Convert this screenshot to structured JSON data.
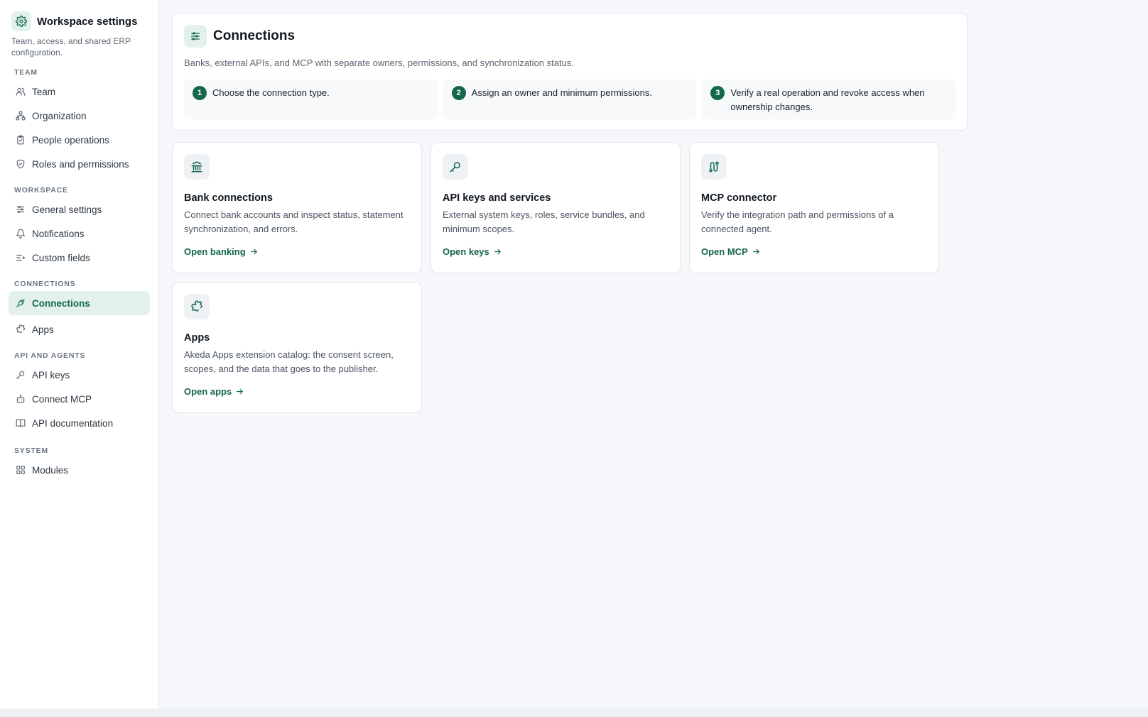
{
  "sidebar": {
    "title": "Workspace settings",
    "subtitle": "Team, access, and shared ERP configuration.",
    "sections": [
      {
        "label": "TEAM",
        "items": [
          {
            "label": "Team",
            "icon": "users-icon"
          },
          {
            "label": "Organization",
            "icon": "org-chart-icon"
          },
          {
            "label": "People operations",
            "icon": "clipboard-icon"
          },
          {
            "label": "Roles and permissions",
            "icon": "shield-icon"
          }
        ]
      },
      {
        "label": "WORKSPACE",
        "items": [
          {
            "label": "General settings",
            "icon": "sliders-icon"
          },
          {
            "label": "Notifications",
            "icon": "bell-icon"
          },
          {
            "label": "Custom fields",
            "icon": "custom-fields-icon"
          }
        ]
      },
      {
        "label": "CONNECTIONS",
        "items": [
          {
            "label": "Connections",
            "icon": "plug-icon",
            "active": true
          },
          {
            "label": "Apps",
            "icon": "puzzle-icon"
          }
        ]
      },
      {
        "label": "API AND AGENTS",
        "items": [
          {
            "label": "API keys",
            "icon": "key-icon"
          },
          {
            "label": "Connect MCP",
            "icon": "bot-icon"
          },
          {
            "label": "API documentation",
            "icon": "book-icon"
          }
        ]
      },
      {
        "label": "SYSTEM",
        "items": [
          {
            "label": "Modules",
            "icon": "modules-icon"
          }
        ]
      }
    ]
  },
  "header": {
    "title": "Connections",
    "description": "Banks, external APIs, and MCP with separate owners, permissions, and synchronization status.",
    "steps": [
      {
        "num": "1",
        "text": "Choose the connection type."
      },
      {
        "num": "2",
        "text": "Assign an owner and minimum permissions."
      },
      {
        "num": "3",
        "text": "Verify a real operation and revoke access when ownership changes."
      }
    ]
  },
  "cards": [
    {
      "title": "Bank connections",
      "description": "Connect bank accounts and inspect status, statement synchronization, and errors.",
      "link": "Open banking",
      "icon": "bank-icon"
    },
    {
      "title": "API keys and services",
      "description": "External system keys, roles, service bundles, and minimum scopes.",
      "link": "Open keys",
      "icon": "key-icon"
    },
    {
      "title": "MCP connector",
      "description": "Verify the integration path and permissions of a connected agent.",
      "link": "Open MCP",
      "icon": "route-icon"
    },
    {
      "title": "Apps",
      "description": "Akeda Apps extension catalog: the consent screen, scopes, and the data that goes to the publisher.",
      "link": "Open apps",
      "icon": "puzzle-icon"
    }
  ],
  "colors": {
    "accent": "#14684a",
    "accent_bg": "#e2f2ea",
    "page_bg": "#f5f7fa"
  }
}
